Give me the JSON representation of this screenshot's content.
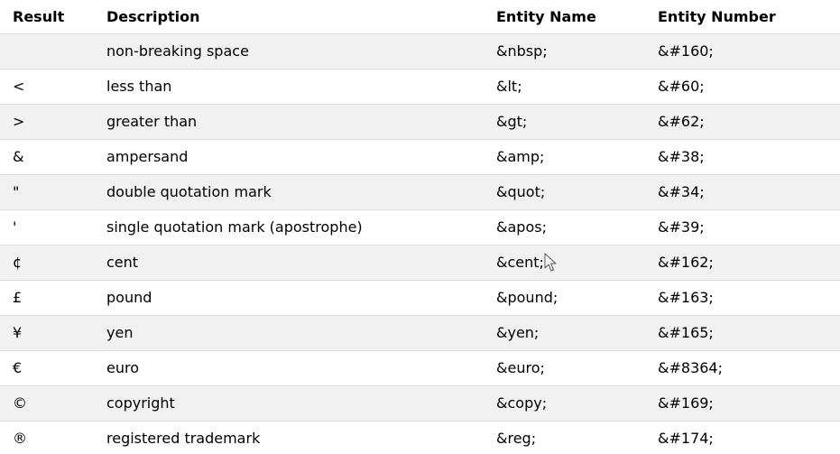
{
  "table": {
    "headers": [
      "Result",
      "Description",
      "Entity Name",
      "Entity Number"
    ],
    "rows": [
      {
        "result": " ",
        "description": "non-breaking space",
        "entity_name": "&nbsp;",
        "entity_number": "&#160;"
      },
      {
        "result": "<",
        "description": "less than",
        "entity_name": "&lt;",
        "entity_number": "&#60;"
      },
      {
        "result": ">",
        "description": "greater than",
        "entity_name": "&gt;",
        "entity_number": "&#62;"
      },
      {
        "result": "&",
        "description": "ampersand",
        "entity_name": "&amp;",
        "entity_number": "&#38;"
      },
      {
        "result": "\"",
        "description": "double quotation mark",
        "entity_name": "&quot;",
        "entity_number": "&#34;"
      },
      {
        "result": "'",
        "description": "single quotation mark (apostrophe)",
        "entity_name": "&apos;",
        "entity_number": "&#39;"
      },
      {
        "result": "¢",
        "description": "cent",
        "entity_name": "&cent;",
        "entity_number": "&#162;"
      },
      {
        "result": "£",
        "description": "pound",
        "entity_name": "&pound;",
        "entity_number": "&#163;"
      },
      {
        "result": "¥",
        "description": "yen",
        "entity_name": "&yen;",
        "entity_number": "&#165;"
      },
      {
        "result": "€",
        "description": "euro",
        "entity_name": "&euro;",
        "entity_number": "&#8364;"
      },
      {
        "result": "©",
        "description": "copyright",
        "entity_name": "&copy;",
        "entity_number": "&#169;"
      },
      {
        "result": "®",
        "description": "registered trademark",
        "entity_name": "&reg;",
        "entity_number": "&#174;"
      }
    ]
  },
  "cursor": {
    "icon": "mouse-pointer-icon"
  },
  "colors": {
    "row_stripe": "#f1f1f1",
    "border": "#dddddd",
    "text": "#000000"
  }
}
